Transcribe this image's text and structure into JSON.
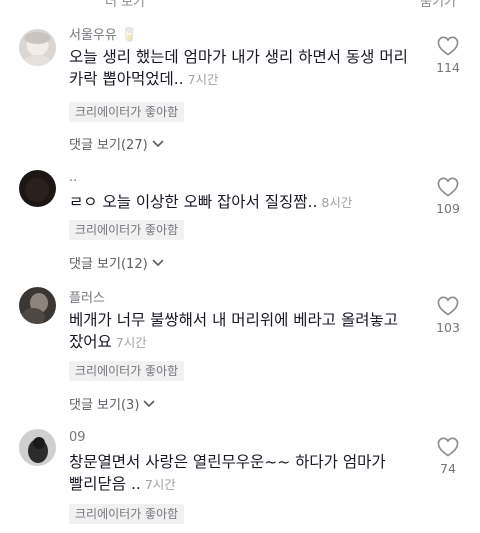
{
  "topbar": {
    "left_text": "더 보기",
    "right_text": "숨기기"
  },
  "comments": [
    {
      "username": "서울우유 🥛",
      "text": "오늘 생리 했는데 엄마가 내가 생리 하면서 동생 머리 카락 뽑아먹었데..",
      "time": "7시간",
      "creator_badge": "크리에이터가 좋아함",
      "replies": "댓글 보기(27)",
      "likes": "114"
    },
    {
      "username": "..",
      "text": "ㄹㅇ 오늘 이상한 오빠 잡아서 질징짬..",
      "time": "8시간",
      "creator_badge": "크리에이터가 좋아함",
      "replies": "댓글 보기(12)",
      "likes": "109"
    },
    {
      "username": "플러스",
      "text": "베개가 너무 불쌍해서 내 머리위에 베라고 올려놓고 잤어요",
      "time": "7시간",
      "creator_badge": "크리에이터가 좋아함",
      "replies": "댓글 보기(3)",
      "likes": "103"
    },
    {
      "username": "09",
      "text": "창문열면서 사랑은 열린무우운~~ 하다가 엄마가 빨리닫음 ..",
      "time": "7시간",
      "creator_badge": "크리에이터가 좋아함",
      "likes": "74"
    }
  ],
  "icons": {
    "like": "heart-outline-icon",
    "expand": "chevron-down-icon"
  }
}
